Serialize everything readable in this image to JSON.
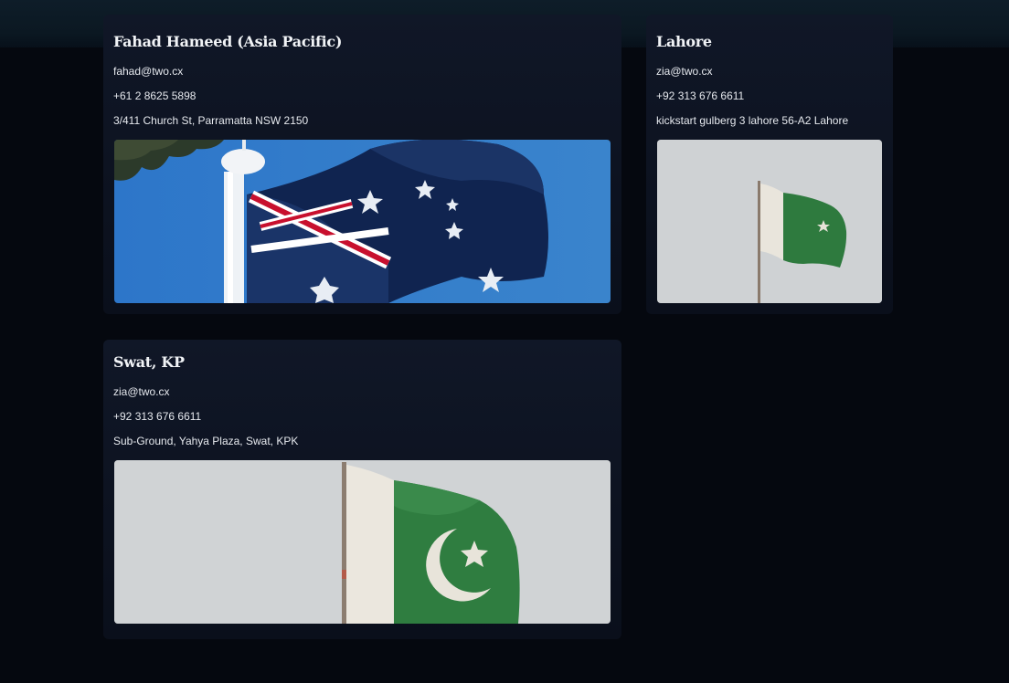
{
  "offices": [
    {
      "title": "Fahad Hameed (Asia Pacific)",
      "email": "fahad@two.cx",
      "phone": "+61 2 8625 5898",
      "address": "3/411 Church St, Parramatta NSW 2150",
      "image": "australian-flag-photo"
    },
    {
      "title": "Lahore",
      "email": "zia@two.cx",
      "phone": "+92 313 676 6611",
      "address": "kickstart gulberg 3 lahore 56-A2 Lahore",
      "image": "pakistan-flag-photo"
    },
    {
      "title": "Swat, KP",
      "email": "zia@two.cx",
      "phone": "+92 313 676 6611",
      "address": "Sub-Ground, Yahya Plaza, Swat, KPK",
      "image": "pakistan-flag-photo"
    }
  ],
  "colors": {
    "background": "#05080f",
    "card": "#0e1424",
    "text": "#e6e9ee"
  }
}
